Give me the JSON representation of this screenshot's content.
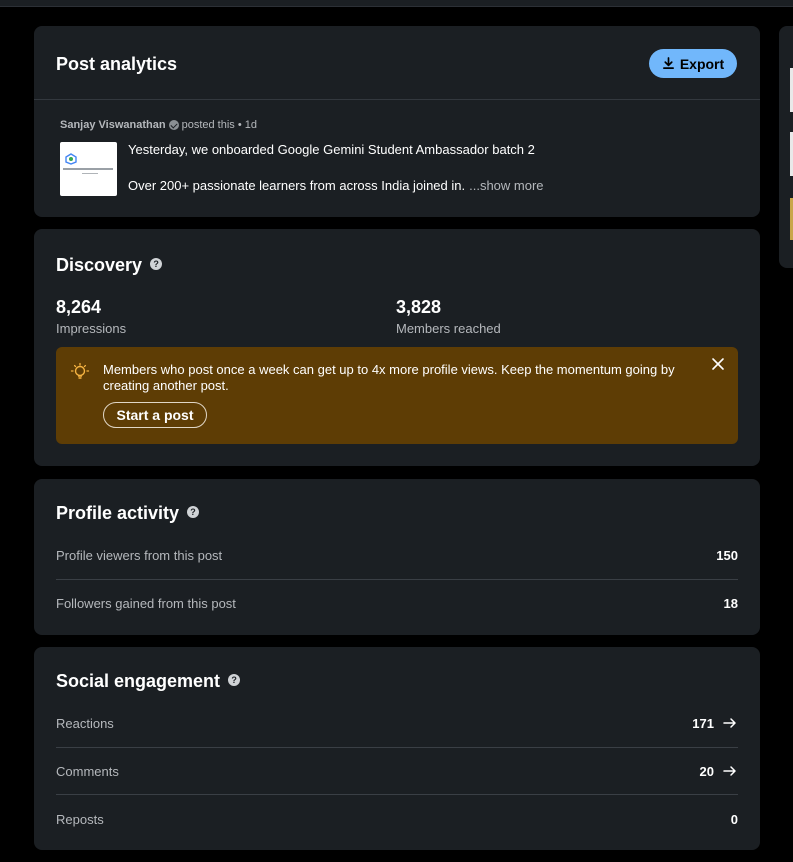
{
  "post_card": {
    "title": "Post analytics",
    "export_label": "Export",
    "author_name": "Sanjay Viswanathan",
    "author_meta": "posted this • 1d",
    "post_line1": "Yesterday, we onboarded Google Gemini Student Ambassador batch 2",
    "post_line2": "Over 200+ passionate learners from across India joined in.",
    "show_more": "...show more"
  },
  "discovery": {
    "title": "Discovery",
    "impressions_value": "8,264",
    "impressions_label": "Impressions",
    "members_value": "3,828",
    "members_label": "Members reached",
    "banner_text": "Members who post once a week can get up to 4x more profile views. Keep the momentum going by creating another post.",
    "banner_button": "Start a post"
  },
  "profile_activity": {
    "title": "Profile activity",
    "rows": [
      {
        "label": "Profile viewers from this post",
        "value": "150"
      },
      {
        "label": "Followers gained from this post",
        "value": "18"
      }
    ]
  },
  "social_engagement": {
    "title": "Social engagement",
    "rows": [
      {
        "label": "Reactions",
        "value": "171"
      },
      {
        "label": "Comments",
        "value": "20"
      },
      {
        "label": "Reposts",
        "value": "0"
      }
    ]
  },
  "icons": {
    "export": "download-icon",
    "help": "help-icon",
    "bulb": "lightbulb-icon",
    "close": "close-icon",
    "arrow": "arrow-right-icon"
  },
  "colors": {
    "background": "#000000",
    "card": "#1b1f23",
    "accent": "#71b7fb",
    "banner": "#5e3d05"
  }
}
